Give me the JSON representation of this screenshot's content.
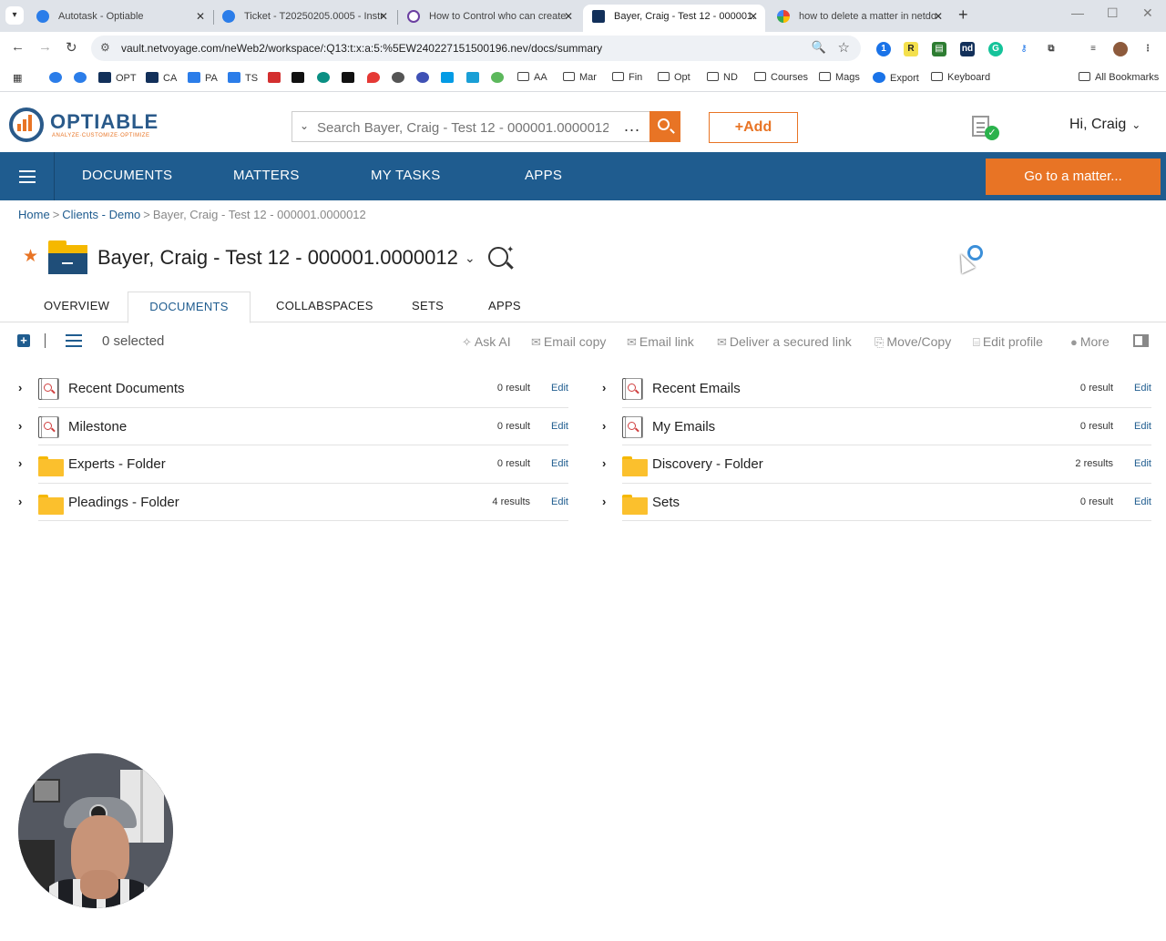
{
  "browser": {
    "tabs": [
      {
        "title": "Autotask - Optiable",
        "active": false
      },
      {
        "title": "Ticket - T20250205.0005 - Instr",
        "active": false
      },
      {
        "title": "How to Control who can create",
        "active": false
      },
      {
        "title": "Bayer, Craig - Test 12 - 000001.",
        "active": true
      },
      {
        "title": "how to delete a matter in netdo",
        "active": false
      }
    ],
    "url": "vault.netvoyage.com/neWeb2/workspace/:Q13:t:x:a:5:%5EW240227151500196.nev/docs/summary",
    "bookmarks": [
      {
        "label": "OPT",
        "type": "site"
      },
      {
        "label": "CA",
        "type": "site"
      },
      {
        "label": "PA",
        "type": "site"
      },
      {
        "label": "TS",
        "type": "site"
      },
      {
        "label": "AA",
        "type": "folder"
      },
      {
        "label": "Mar",
        "type": "folder"
      },
      {
        "label": "Fin",
        "type": "folder"
      },
      {
        "label": "Opt",
        "type": "folder"
      },
      {
        "label": "ND",
        "type": "folder"
      },
      {
        "label": "Courses",
        "type": "folder"
      },
      {
        "label": "Mags",
        "type": "folder"
      },
      {
        "label": "Export",
        "type": "site"
      },
      {
        "label": "Keyboard",
        "type": "folder"
      },
      {
        "label": "All Bookmarks",
        "type": "folder"
      }
    ]
  },
  "header": {
    "logo_text": "OPTIABLE",
    "logo_tagline": "ANALYZE·CUSTOMIZE·OPTIMIZE",
    "search_placeholder": "Search Bayer, Craig - Test 12 - 000001.0000012",
    "search_more": "...",
    "add_label": "Add",
    "greeting": "Hi, Craig"
  },
  "nav": {
    "items": [
      "DOCUMENTS",
      "MATTERS",
      "MY TASKS",
      "APPS"
    ],
    "goto_label": "Go to a matter..."
  },
  "breadcrumb": {
    "home": "Home",
    "parent": "Clients - Demo",
    "current": "Bayer, Craig - Test 12 - 000001.0000012"
  },
  "page": {
    "title": "Bayer, Craig - Test 12 - 000001.0000012"
  },
  "subtabs": [
    "OVERVIEW",
    "DOCUMENTS",
    "COLLABSPACES",
    "SETS",
    "APPS"
  ],
  "actions": {
    "selected": "0 selected",
    "buttons": [
      "Ask AI",
      "Email copy",
      "Email link",
      "Deliver a secured link",
      "Move/Copy",
      "Edit profile",
      "More"
    ]
  },
  "left_column": [
    {
      "name": "Recent Documents",
      "icon": "saved-search-icon",
      "count": "0 result",
      "edit": "Edit"
    },
    {
      "name": "Milestone",
      "icon": "saved-search-icon",
      "count": "0 result",
      "edit": "Edit"
    },
    {
      "name": "Experts - Folder",
      "icon": "folder-icon",
      "count": "0 result",
      "edit": "Edit"
    },
    {
      "name": "Pleadings - Folder",
      "icon": "folder-icon",
      "count": "4 results",
      "edit": "Edit"
    }
  ],
  "right_column": [
    {
      "name": "Recent Emails",
      "icon": "saved-search-icon",
      "count": "0 result",
      "edit": "Edit"
    },
    {
      "name": "My Emails",
      "icon": "saved-search-icon",
      "count": "0 result",
      "edit": "Edit"
    },
    {
      "name": "Discovery - Folder",
      "icon": "folder-icon",
      "count": "2 results",
      "edit": "Edit"
    },
    {
      "name": "Sets",
      "icon": "folder-icon",
      "count": "0 result",
      "edit": "Edit"
    }
  ],
  "colors": {
    "brand_blue": "#1f5c8f",
    "accent_orange": "#e87425",
    "folder_yellow": "#fbc02d"
  }
}
